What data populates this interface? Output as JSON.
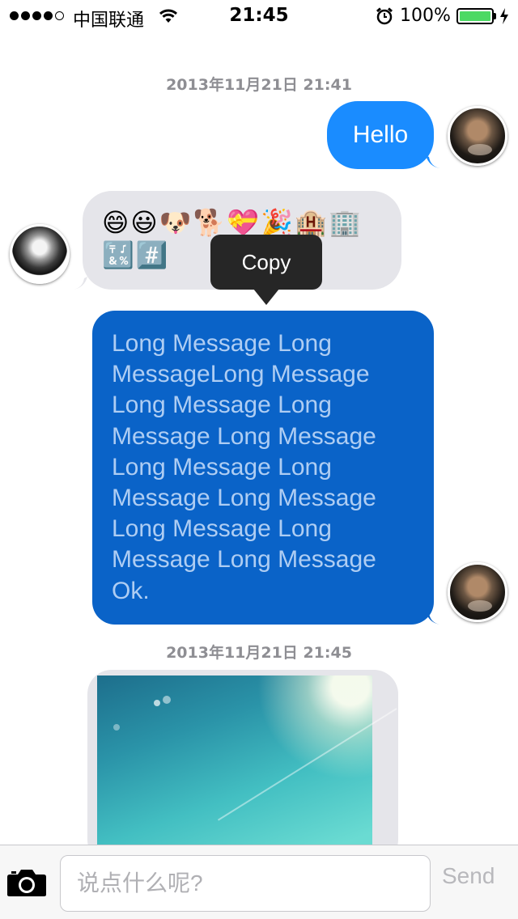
{
  "status_bar": {
    "carrier": "中国联通",
    "time": "21:45",
    "battery_percent": "100%",
    "signal_bars_filled": 4,
    "signal_bars_total": 5,
    "battery_level": 1.0,
    "battery_color": "#4cd964"
  },
  "timestamps": [
    "2013年11月21日 21:41",
    "2013年11月21日 21:45"
  ],
  "messages": [
    {
      "sender": "self",
      "avatar": "avatar-woz",
      "type": "text",
      "text": "Hello",
      "bubble_color": "#1a8cff"
    },
    {
      "sender": "other",
      "avatar": "avatar-jobs",
      "type": "emoji",
      "emoji_rows": [
        [
          "😄",
          "😃",
          "🐶",
          "🐕",
          "💝",
          "🎉",
          "🏨",
          "🏢"
        ],
        [
          "🔣",
          "#️⃣"
        ]
      ],
      "bubble_color": "#e5e5ea"
    },
    {
      "sender": "self",
      "avatar": "avatar-woz",
      "type": "text",
      "text": "Long Message Long MessageLong Message Long Message Long Message Long Message Long Message Long Message Long Message Long Message Long Message Long Message Ok.",
      "bubble_color": "#0a63c8",
      "selected": true
    },
    {
      "sender": "other",
      "type": "image",
      "bubble_color": "#e5e5ea"
    }
  ],
  "context_menu": {
    "copy_label": "Copy"
  },
  "input_bar": {
    "placeholder": "说点什么呢?",
    "send_label": "Send",
    "camera_icon": "camera-icon"
  }
}
